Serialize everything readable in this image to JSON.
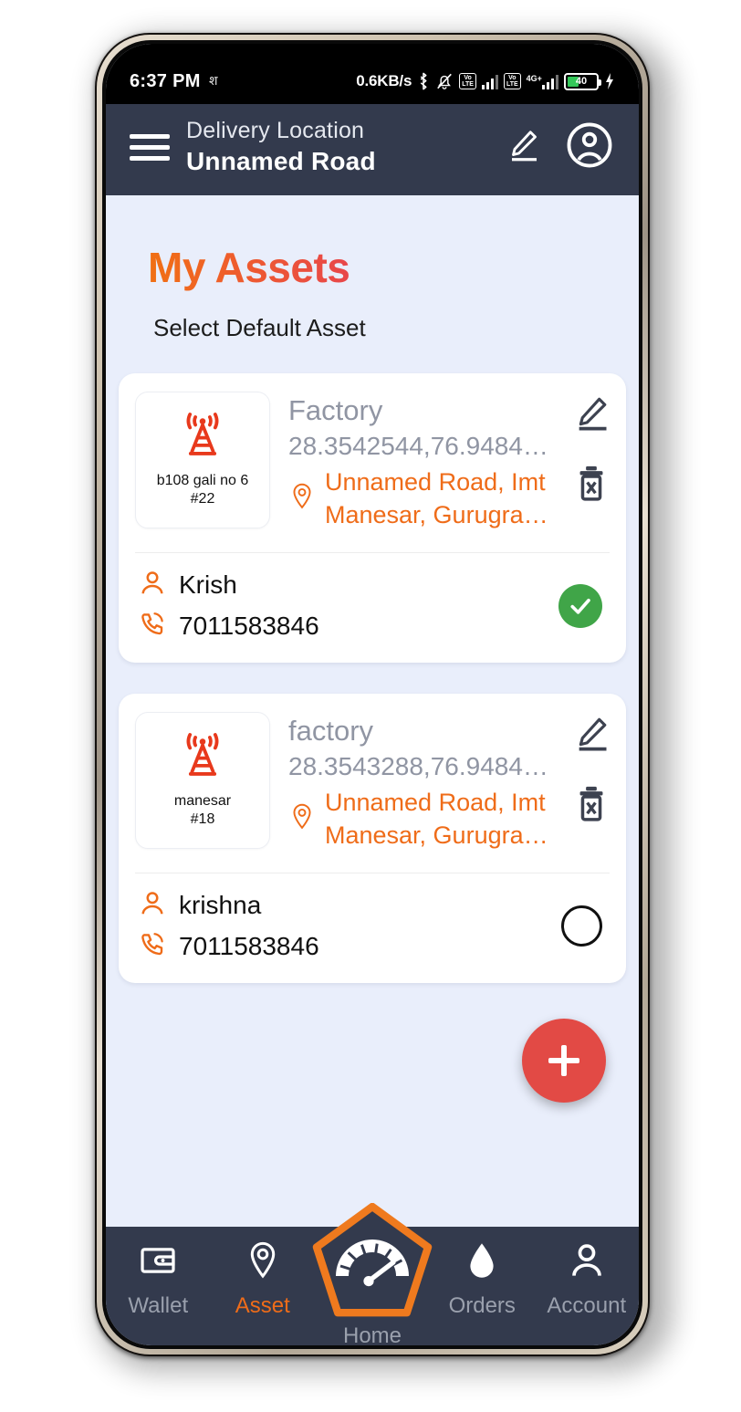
{
  "statusbar": {
    "time": "6:37 PM",
    "notification_glyph": "श",
    "network_speed": "0.6KB/s",
    "bluetooth_icon": "bluetooth-icon",
    "silent_icon": "bell-off-icon",
    "volte_label": "Vo\nLTE",
    "volte_text_top": "Vo",
    "volte_text_bottom": "LTE",
    "data_type": "4G+",
    "battery_percent": "40",
    "charging_icon": "lightning-bolt-icon"
  },
  "appbar": {
    "menu_icon": "hamburger-menu-icon",
    "subtitle": "Delivery Location",
    "title": "Unnamed Road",
    "edit_icon": "pencil-edit-icon",
    "profile_icon": "account-circle-icon"
  },
  "page": {
    "title": "My Assets",
    "subtitle": "Select Default Asset",
    "title_gradient_from": "#f07014",
    "title_gradient_to": "#e8464a",
    "background": "#e9eefb"
  },
  "assets": [
    {
      "thumb_icon": "radio-tower-icon",
      "thumb_label_line1": "b108 gali no 6",
      "thumb_label_line2": "#22",
      "name": "Factory",
      "coords": "28.3542544,76.9484…",
      "address_line1": "Unnamed Road, Imt",
      "address_line2": "Manesar, Gurugra…",
      "location_icon": "map-pin-icon",
      "edit_icon": "pencil-edit-icon",
      "delete_icon": "trash-delete-icon",
      "contact_name": "Krish",
      "contact_phone": "7011583846",
      "person_icon": "person-icon",
      "phone_icon": "phone-call-icon",
      "selected": true,
      "select_icon": "check-circle-filled-icon"
    },
    {
      "thumb_icon": "radio-tower-icon",
      "thumb_label_line1": "manesar",
      "thumb_label_line2": "#18",
      "name": "factory",
      "coords": "28.3543288,76.9484…",
      "address_line1": "Unnamed Road, Imt",
      "address_line2": "Manesar, Gurugra…",
      "location_icon": "map-pin-icon",
      "edit_icon": "pencil-edit-icon",
      "delete_icon": "trash-delete-icon",
      "contact_name": "krishna",
      "contact_phone": "7011583846",
      "person_icon": "person-icon",
      "phone_icon": "phone-call-icon",
      "selected": false,
      "select_icon": "circle-outline-icon"
    }
  ],
  "fab": {
    "icon": "plus-icon",
    "color": "#e24a45"
  },
  "bottomnav": {
    "background": "#333a4d",
    "active_color": "#ef6c19",
    "inactive_color": "#9aa0ad",
    "items": [
      {
        "label": "Wallet",
        "icon": "wallet-icon",
        "active": false
      },
      {
        "label": "Asset",
        "icon": "map-pin-icon",
        "active": true
      },
      {
        "label": "Home",
        "icon": "speedometer-gauge-icon",
        "active": false
      },
      {
        "label": "Orders",
        "icon": "fuel-droplet-icon",
        "active": false
      },
      {
        "label": "Account",
        "icon": "person-icon",
        "active": false
      }
    ]
  }
}
